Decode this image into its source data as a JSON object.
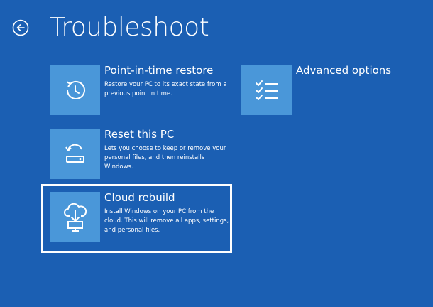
{
  "page": {
    "title": "Troubleshoot"
  },
  "icons": {
    "back": "back-arrow-icon",
    "restore": "history-restore-icon",
    "reset": "reset-pc-icon",
    "cloud": "cloud-download-icon",
    "advanced": "checklist-icon"
  },
  "colors": {
    "background": "#1b5fb3",
    "tile": "#4a97d9",
    "text": "#ffffff"
  },
  "options": {
    "restore": {
      "label": "Point-in-time restore",
      "description": "Restore your PC to its exact state from a previous point in time."
    },
    "reset": {
      "label": "Reset this PC",
      "description": "Lets you choose to keep or remove your personal files, and then reinstalls Windows."
    },
    "cloud": {
      "label": "Cloud rebuild",
      "description": "Install Windows on your PC from the cloud. This will remove all apps, settings, and personal files."
    },
    "advanced": {
      "label": "Advanced options"
    }
  }
}
